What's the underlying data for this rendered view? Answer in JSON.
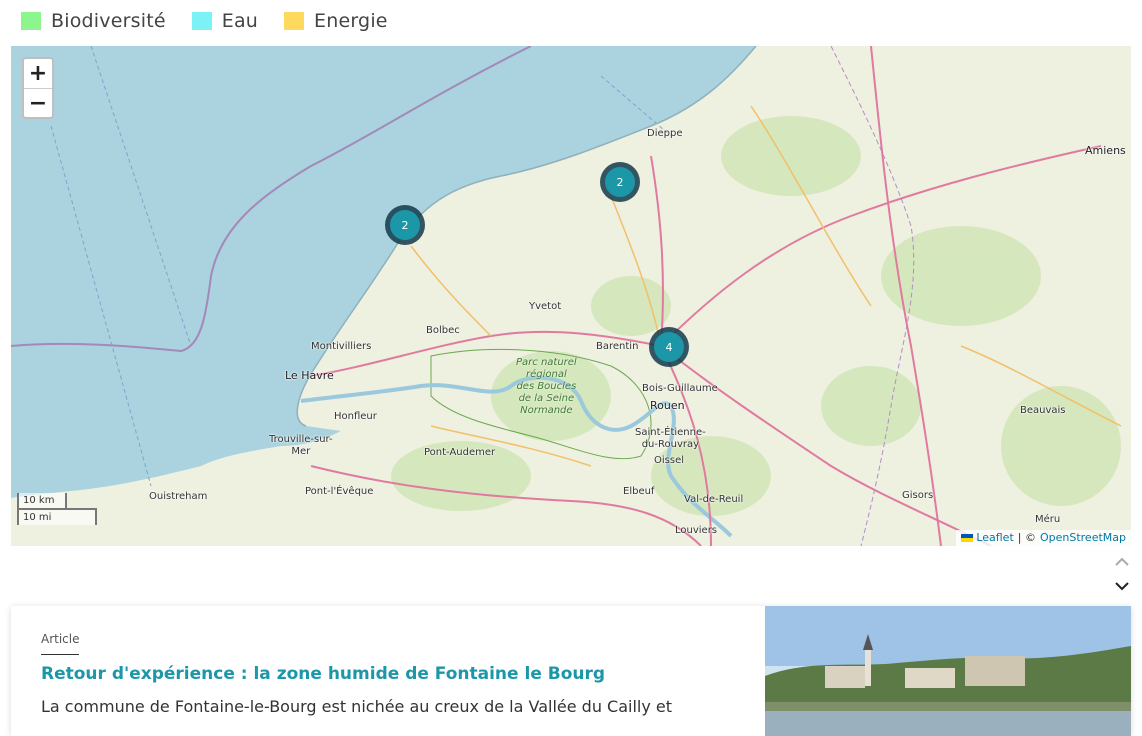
{
  "legend": [
    {
      "label": "Biodiversité",
      "color": "#8ef58e"
    },
    {
      "label": "Eau",
      "color": "#7cf1f6"
    },
    {
      "label": "Energie",
      "color": "#ffd95e"
    }
  ],
  "map": {
    "zoom_in": "+",
    "zoom_out": "−",
    "clusters": [
      "2",
      "2",
      "4"
    ],
    "places": {
      "dieppe": "Dieppe",
      "amiens": "Amiens",
      "yvetot": "Yvetot",
      "bolbec": "Bolbec",
      "montivilliers": "Montivilliers",
      "le_havre": "Le Havre",
      "barentin": "Barentin",
      "bois_guillaume": "Bois-Guillaume",
      "rouen": "Rouen",
      "honfleur": "Honfleur",
      "trouville": "Trouville-sur-\nMer",
      "pont_audemer": "Pont-Audemer",
      "saint_etienne": "Saint-Étienne-\ndu-Rouvray",
      "oissel": "Oissel",
      "beauvais": "Beauvais",
      "ouistreham": "Ouistreham",
      "pont_leveque": "Pont-l'Évêque",
      "elbeuf": "Elbeuf",
      "val_de_reuil": "Val-de-Reuil",
      "gisors": "Gisors",
      "meru": "Méru",
      "louviers": "Louviers"
    },
    "park_label": "Parc naturel\nrégional\ndes Boucles\nde la Seine\nNormande",
    "scale_km": "10 km",
    "scale_mi": "10 mi",
    "attribution": {
      "leaflet": "Leaflet",
      "separator": "| ©",
      "osm": "OpenStreetMap"
    }
  },
  "card": {
    "type": "Article",
    "title": "Retour d'expérience : la zone humide de Fontaine le Bourg",
    "excerpt": "La commune de Fontaine-le-Bourg est nichée au creux de la Vallée du Cailly et"
  },
  "colors": {
    "accent": "#1b97a8",
    "sea": "#aad3df",
    "land": "#f2efe9"
  }
}
